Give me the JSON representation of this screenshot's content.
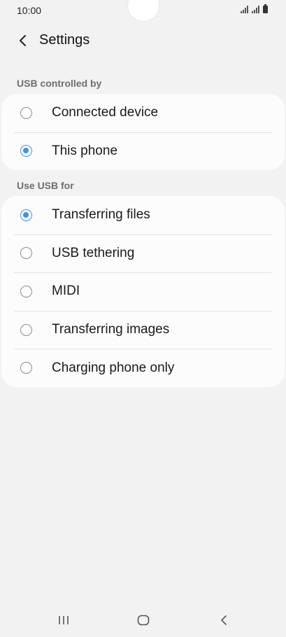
{
  "status_bar": {
    "time": "10:00"
  },
  "header": {
    "back_icon": "chevron-left-icon",
    "title": "Settings"
  },
  "sections": [
    {
      "header": "USB controlled by",
      "options": [
        {
          "label": "Connected device",
          "selected": false
        },
        {
          "label": "This phone",
          "selected": true
        }
      ]
    },
    {
      "header": "Use USB for",
      "options": [
        {
          "label": "Transferring files",
          "selected": true
        },
        {
          "label": "USB tethering",
          "selected": false
        },
        {
          "label": "MIDI",
          "selected": false
        },
        {
          "label": "Transferring images",
          "selected": false
        },
        {
          "label": "Charging phone only",
          "selected": false
        }
      ]
    }
  ],
  "nav_bar": {
    "recents_icon": "recents-icon",
    "home_icon": "home-icon",
    "back_icon": "back-icon"
  },
  "colors": {
    "accent": "#3e91f5",
    "background": "#f2f2f2",
    "card": "#fcfcfc"
  }
}
